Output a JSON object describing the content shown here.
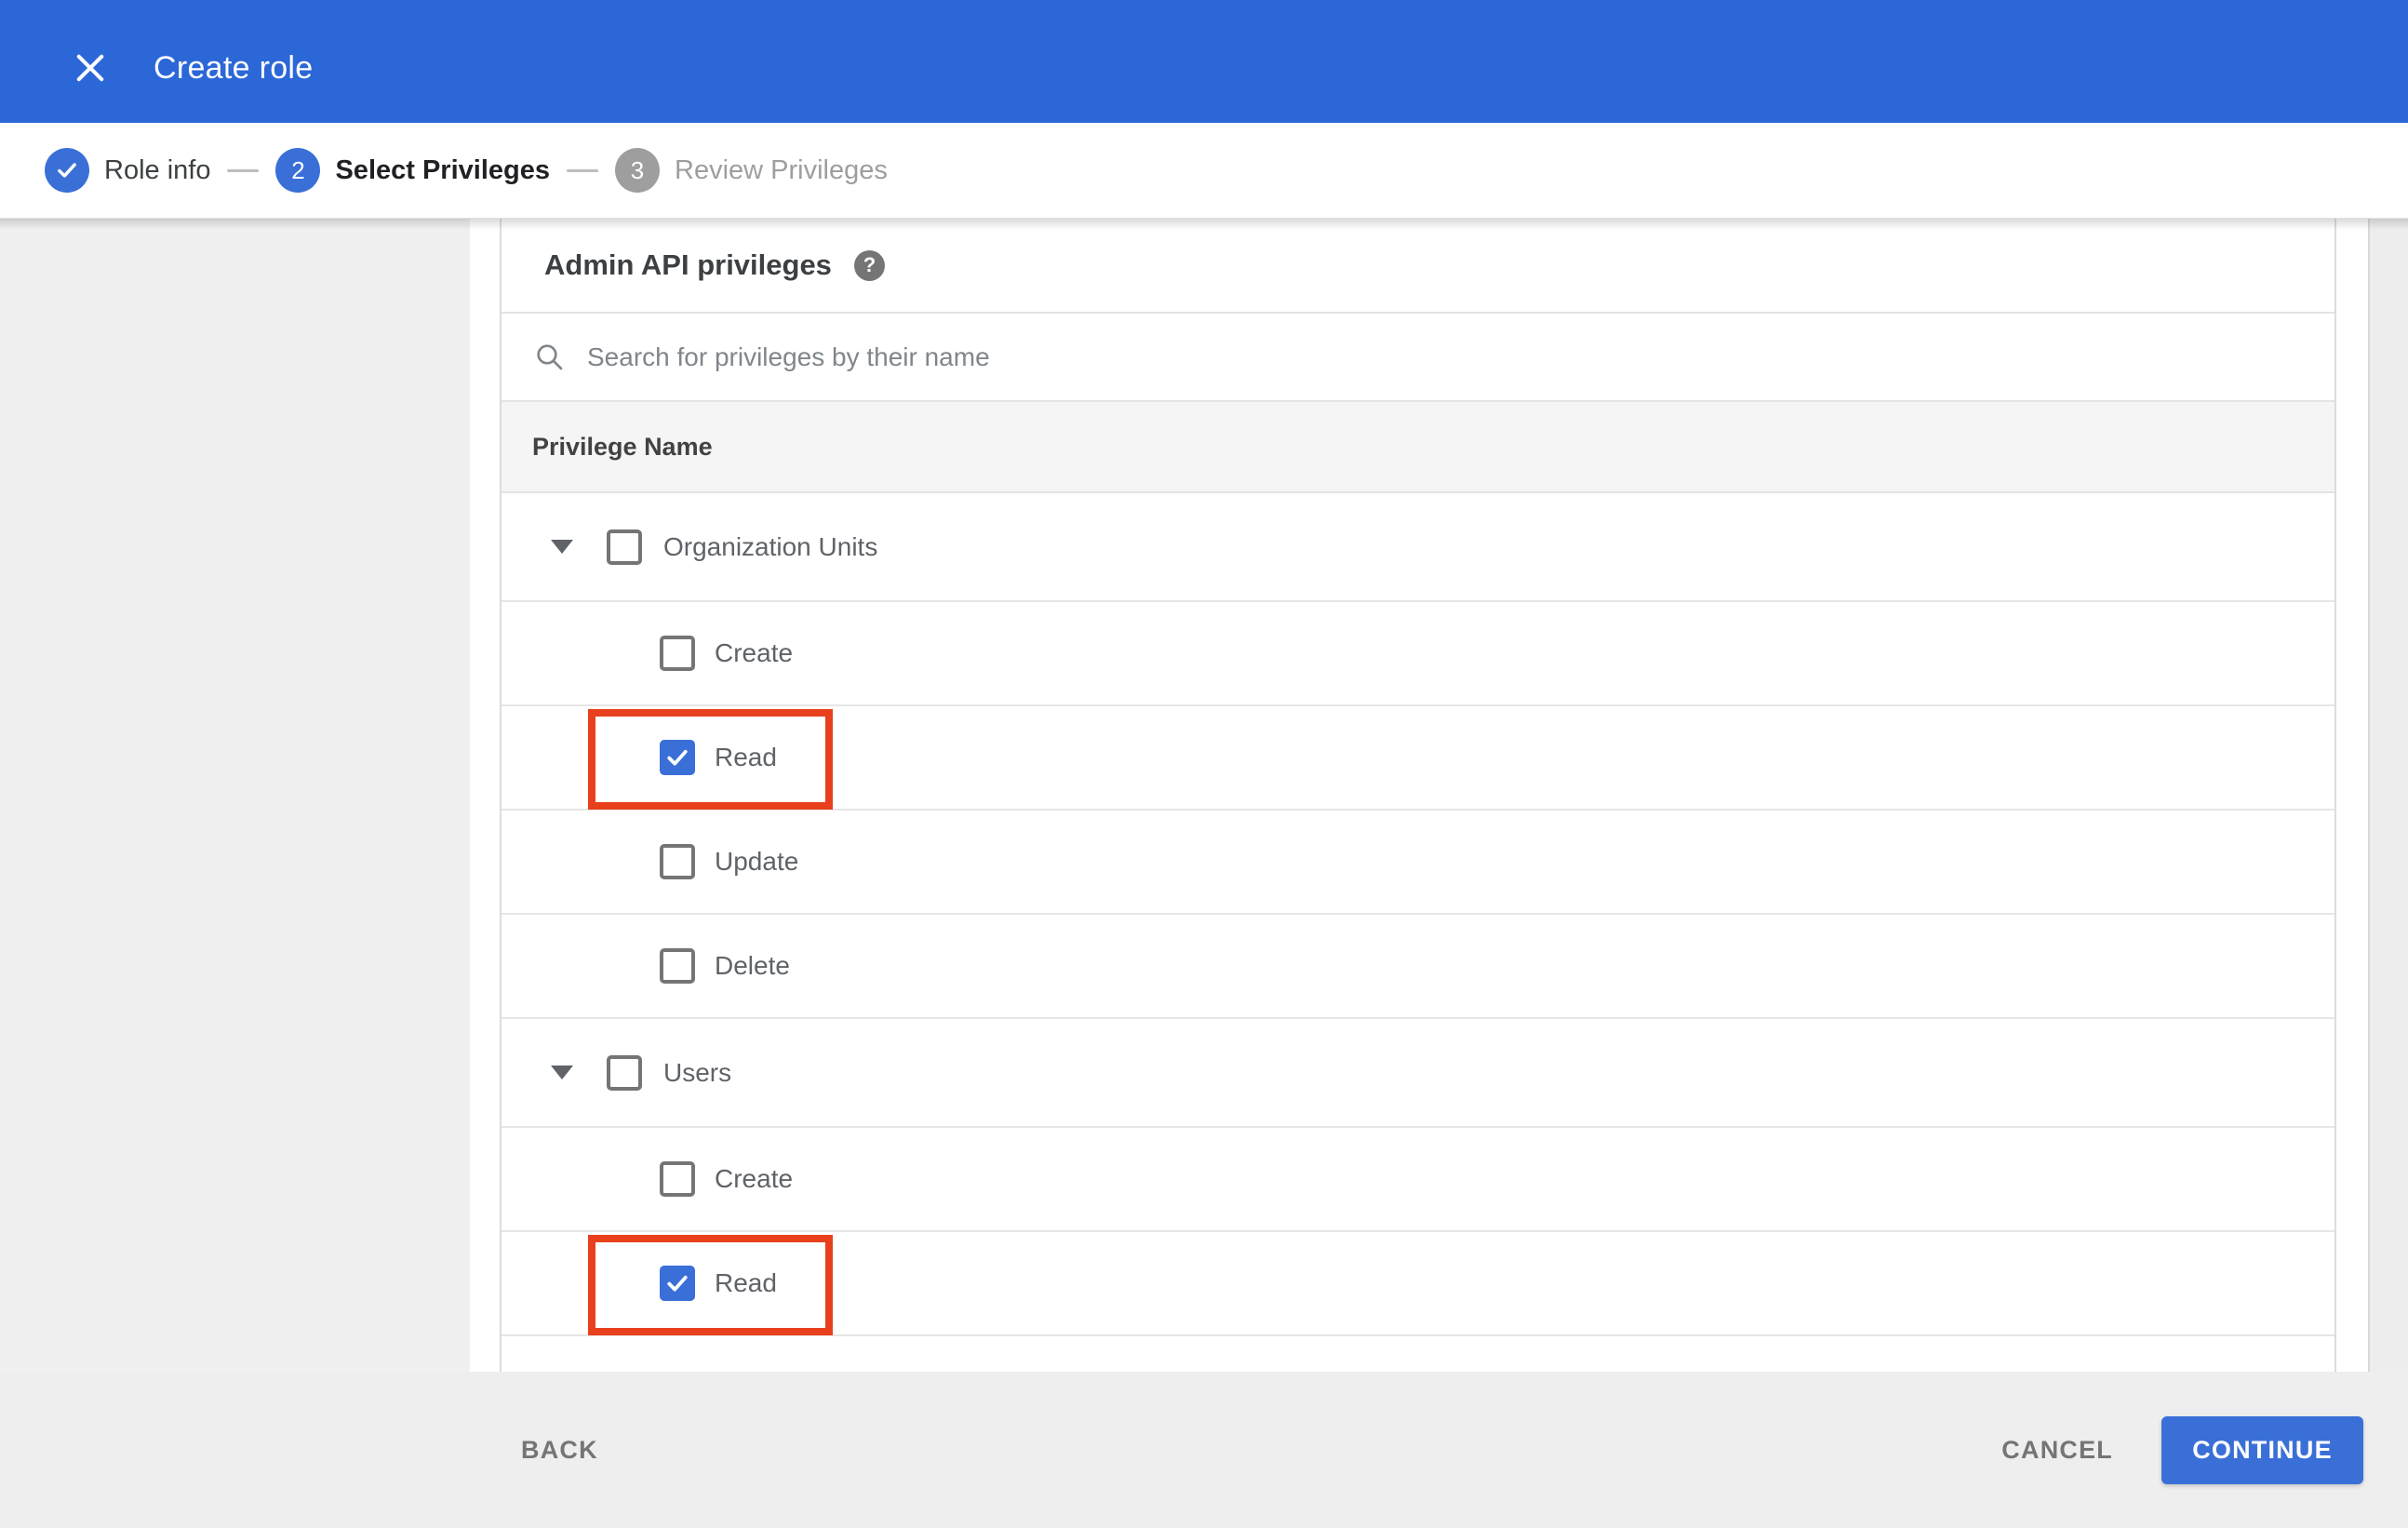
{
  "header": {
    "title": "Create role"
  },
  "stepper": {
    "steps": [
      {
        "number": "1",
        "label": "Role info",
        "state": "completed"
      },
      {
        "number": "2",
        "label": "Select Privileges",
        "state": "active"
      },
      {
        "number": "3",
        "label": "Review Privileges",
        "state": "upcoming"
      }
    ]
  },
  "content": {
    "section_title": "Admin API privileges",
    "help_icon_glyph": "?",
    "search": {
      "value": "",
      "placeholder": "Search for privileges by their name"
    },
    "table": {
      "column_header": "Privilege Name",
      "rows": [
        {
          "type": "section",
          "label": "Organization Units",
          "checked": false,
          "highlighted": false
        },
        {
          "type": "child",
          "label": "Create",
          "checked": false,
          "highlighted": false
        },
        {
          "type": "child",
          "label": "Read",
          "checked": true,
          "highlighted": true
        },
        {
          "type": "child",
          "label": "Update",
          "checked": false,
          "highlighted": false
        },
        {
          "type": "child",
          "label": "Delete",
          "checked": false,
          "highlighted": false
        },
        {
          "type": "section",
          "label": "Users",
          "checked": false,
          "highlighted": false
        },
        {
          "type": "child",
          "label": "Create",
          "checked": false,
          "highlighted": false
        },
        {
          "type": "child",
          "label": "Read",
          "checked": true,
          "highlighted": true
        }
      ]
    }
  },
  "footer": {
    "back_label": "BACK",
    "cancel_label": "CANCEL",
    "continue_label": "CONTINUE"
  },
  "colors": {
    "header_blue": "#2c67d8",
    "accent_blue": "#3a6fd8",
    "inactive_gray": "#9e9e9e",
    "highlight_red": "#e8401c",
    "footer_bg": "#eeeeee"
  }
}
